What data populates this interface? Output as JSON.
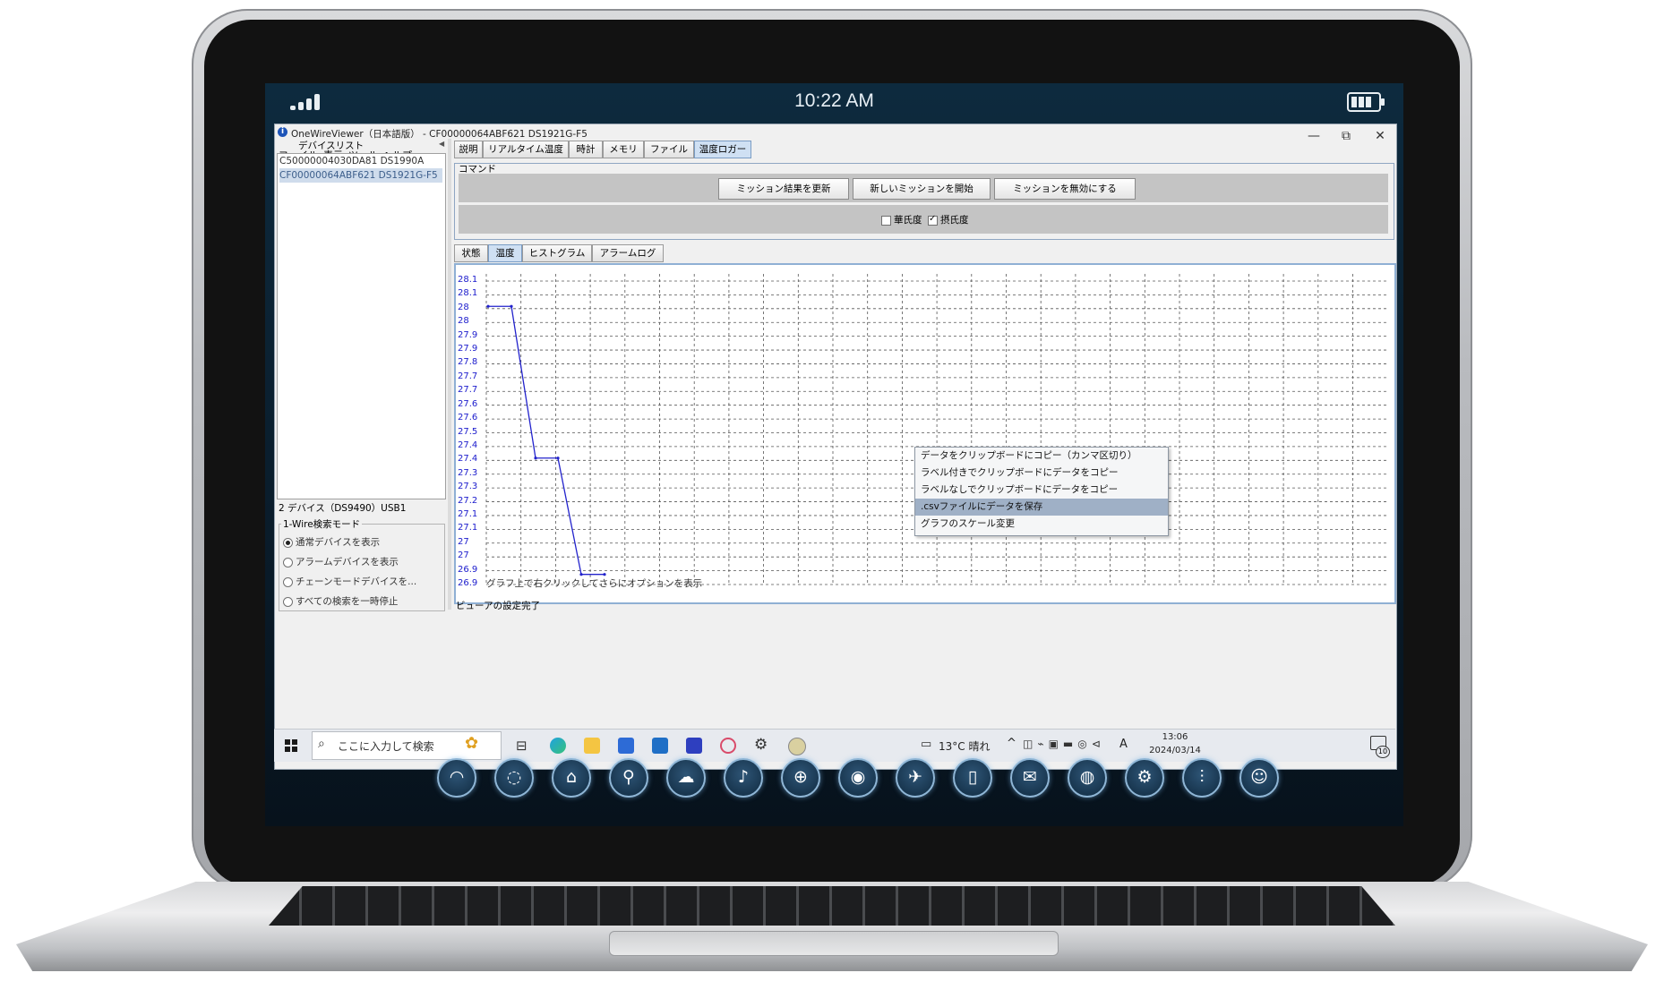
{
  "status_bar": {
    "time": "10:22 AM"
  },
  "window": {
    "title": "OneWireViewer（日本語版） - CF00000064ABF621 DS1921G-F5",
    "minimize": "—",
    "restore": "⧉",
    "close": "✕",
    "menu": [
      "ファイル",
      "表示",
      "ツール",
      "ヘルプ"
    ]
  },
  "device_panel": {
    "header": "デバイスリスト",
    "devices": [
      "C50000004030DA81 DS1990A",
      "CF00000064ABF621 DS1921G-F5"
    ],
    "selected_index": 1,
    "status": "2 デバイス（DS9490）USB1",
    "search_mode": {
      "title": "1-Wire検索モード",
      "options": [
        "通常デバイスを表示",
        "アラームデバイスを表示",
        "チェーンモードデバイスを...",
        "すべての検索を一時停止"
      ],
      "selected_index": 0
    }
  },
  "main_tabs": [
    "説明",
    "リアルタイム温度",
    "時計",
    "メモリ",
    "ファイル",
    "温度ロガー"
  ],
  "main_tab_selected": 5,
  "command": {
    "title": "コマンド",
    "buttons": [
      "ミッション結果を更新",
      "新しいミッションを開始",
      "ミッションを無効にする"
    ],
    "checkboxes": [
      {
        "label": "華氏度",
        "checked": false
      },
      {
        "label": "摂氏度",
        "checked": true
      }
    ]
  },
  "sub_tabs": [
    "状態",
    "温度",
    "ヒストグラム",
    "アラームログ"
  ],
  "sub_tab_selected": 1,
  "chart_data": {
    "type": "line",
    "y_tick_labels": [
      "28.1",
      "28.1",
      "28",
      "28",
      "27.9",
      "27.9",
      "27.8",
      "27.7",
      "27.7",
      "27.6",
      "27.6",
      "27.5",
      "27.4",
      "27.4",
      "27.3",
      "27.3",
      "27.2",
      "27.1",
      "27.1",
      "27",
      "27",
      "26.9",
      "26.9"
    ],
    "ylim": [
      26.9,
      28.1
    ],
    "grid": true,
    "points": [
      {
        "x": 0,
        "y": 28.0
      },
      {
        "x": 1,
        "y": 28.0
      },
      {
        "x": 2,
        "y": 27.4
      },
      {
        "x": 3,
        "y": 27.4
      },
      {
        "x": 4,
        "y": 26.94
      },
      {
        "x": 5,
        "y": 26.94
      }
    ],
    "line_color": "#2222cc"
  },
  "chart_hint": "グラフ上で右クリックしてさらにオプションを表示",
  "context_menu": {
    "items": [
      "データをクリップボードにコピー（カンマ区切り）",
      "ラベル付きでクリップボードにデータをコピー",
      "ラベルなしでクリップボードにデータをコピー",
      ".csvファイルにデータを保存",
      "グラフのスケール変更"
    ],
    "highlighted_index": 3
  },
  "status_line": "ビューアの設定完了",
  "taskbar": {
    "search_placeholder": "ここに入力して検索",
    "weather": "13°C 晴れ",
    "ime": "A",
    "time": "13:06",
    "date": "2024/03/14",
    "notifications": "10"
  },
  "dock_icons": [
    "wifi-icon",
    "chat-icon",
    "home-icon",
    "search-icon",
    "cloud-icon",
    "microphone-icon",
    "gamepad-icon",
    "camera-icon",
    "airplane-icon",
    "phone-icon",
    "mail-icon",
    "globe-icon",
    "settings-icon",
    "equalizer-icon",
    "user-icon"
  ]
}
